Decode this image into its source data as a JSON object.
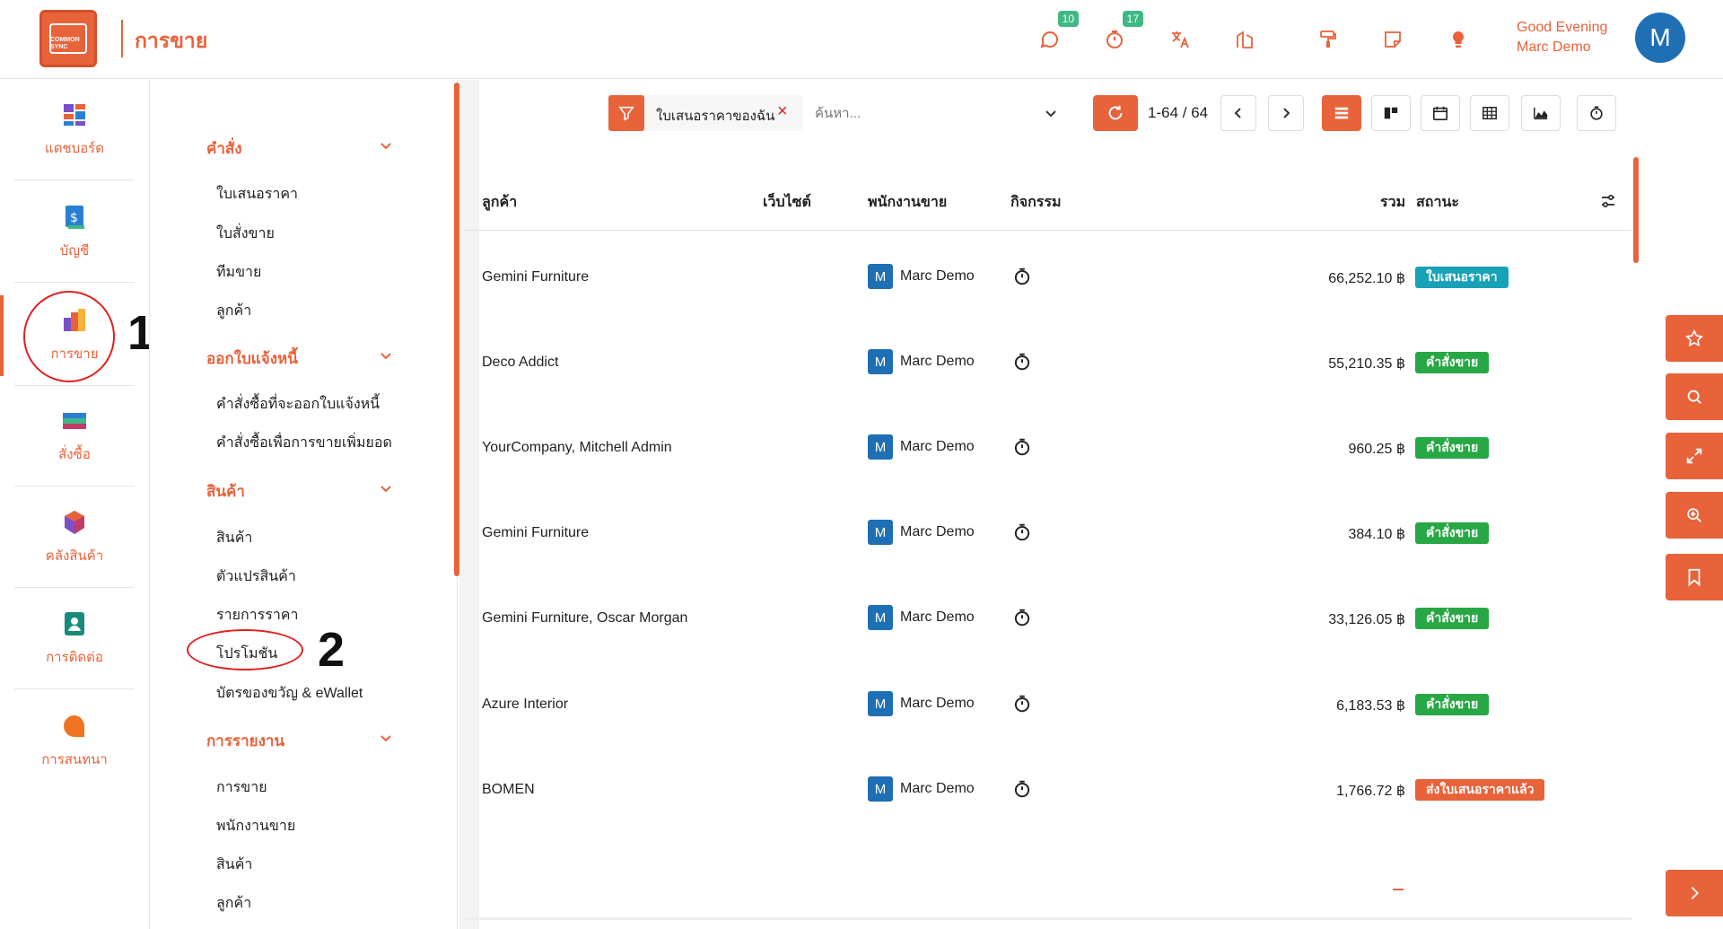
{
  "app": {
    "logo_text": "COMMON SYNC",
    "title": "การขาย"
  },
  "topbar": {
    "messages_badge": "10",
    "activities_badge": "17",
    "greeting_line1": "Good Evening",
    "greeting_line2": "Marc Demo",
    "avatar_letter": "M"
  },
  "rail": {
    "items": [
      {
        "label": "แดชบอร์ด",
        "icon": "dashboard-icon"
      },
      {
        "label": "บัญชี",
        "icon": "accounting-icon"
      },
      {
        "label": "การขาย",
        "icon": "sales-icon"
      },
      {
        "label": "สั่งซื้อ",
        "icon": "purchase-icon"
      },
      {
        "label": "คลังสินค้า",
        "icon": "inventory-icon"
      },
      {
        "label": "การติดต่อ",
        "icon": "contacts-icon"
      },
      {
        "label": "การสนทนา",
        "icon": "discuss-icon"
      }
    ]
  },
  "annotations": {
    "one": "1",
    "two": "2"
  },
  "submenu": {
    "sections": [
      {
        "title": "คำสั่ง",
        "items": [
          "ใบเสนอราคา",
          "ใบสั่งขาย",
          "ทีมขาย",
          "ลูกค้า"
        ]
      },
      {
        "title": "ออกใบแจ้งหนี้",
        "items": [
          "คำสั่งซื้อที่จะออกใบแจ้งหนี้",
          "คำสั่งซื้อเพื่อการขายเพิ่มยอด"
        ]
      },
      {
        "title": "สินค้า",
        "items": [
          "สินค้า",
          "ตัวแปรสินค้า",
          "รายการราคา",
          "โปรโมชัน",
          "บัตรของขวัญ & eWallet"
        ]
      },
      {
        "title": "การรายงาน",
        "items": [
          "การขาย",
          "พนักงานขาย",
          "สินค้า",
          "ลูกค้า"
        ]
      }
    ]
  },
  "controls": {
    "filter_label": "ใบเสนอราคาของฉัน",
    "search_placeholder": "ค้นหา...",
    "pager": "1-64 / 64"
  },
  "table": {
    "headers": {
      "customer": "ลูกค้า",
      "website": "เว็บไซต์",
      "salesperson": "พนักงานขาย",
      "activity": "กิจกรรม",
      "total": "รวม",
      "status": "สถานะ"
    },
    "rows": [
      {
        "customer": "Gemini Furniture",
        "person_initial": "M",
        "person": "Marc Demo",
        "amount": "66,252.10 ฿",
        "status": "ใบเสนอราคา",
        "status_color": "#17a2b8"
      },
      {
        "customer": "Deco Addict",
        "person_initial": "M",
        "person": "Marc Demo",
        "amount": "55,210.35 ฿",
        "status": "คำสั่งขาย",
        "status_color": "#28a745"
      },
      {
        "customer": "YourCompany, Mitchell Admin",
        "person_initial": "M",
        "person": "Marc Demo",
        "amount": "960.25 ฿",
        "status": "คำสั่งขาย",
        "status_color": "#28a745"
      },
      {
        "customer": "Gemini Furniture",
        "person_initial": "M",
        "person": "Marc Demo",
        "amount": "384.10 ฿",
        "status": "คำสั่งขาย",
        "status_color": "#28a745"
      },
      {
        "customer": "Gemini Furniture, Oscar Morgan",
        "person_initial": "M",
        "person": "Marc Demo",
        "amount": "33,126.05 ฿",
        "status": "คำสั่งขาย",
        "status_color": "#28a745"
      },
      {
        "customer": "Azure Interior",
        "person_initial": "M",
        "person": "Marc Demo",
        "amount": "6,183.53 ฿",
        "status": "คำสั่งขาย",
        "status_color": "#28a745"
      },
      {
        "customer": "BOMEN",
        "person_initial": "M",
        "person": "Marc Demo",
        "amount": "1,766.72 ฿",
        "status": "ส่งใบเสนอราคาแล้ว",
        "status_color": "#e8623a"
      }
    ]
  },
  "colors": {
    "accent": "#e8623a",
    "annotation_red": "#e02020",
    "avatar_blue": "#1f6fb5"
  }
}
